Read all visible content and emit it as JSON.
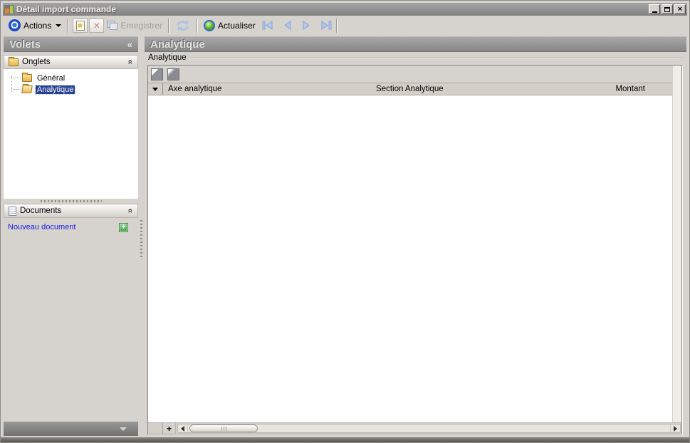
{
  "window": {
    "title": "Détail import commande",
    "close_glyph": "×"
  },
  "toolbar": {
    "actions_label": "Actions",
    "save_label": "Enregistrer",
    "refresh_label": "Actualiser"
  },
  "sidebar": {
    "header": "Volets",
    "collapse_glyph": "«",
    "onglets_title": "Onglets",
    "documents_title": "Documents",
    "section_collapse_glyph": "«",
    "tree": [
      {
        "label": "Général"
      },
      {
        "label": "Analytique"
      }
    ],
    "new_document_label": "Nouveau document",
    "new_document_plus": "+"
  },
  "main": {
    "header": "Analytique",
    "group_label": "Analytique",
    "grid": {
      "columns": [
        "Axe analytique",
        "Section Analytique",
        "Montant"
      ],
      "rows": [],
      "add_row_glyph": "+"
    }
  },
  "colors": {
    "selection": "#26418f",
    "link": "#1a1ae6",
    "add_green": "#3f9e3f",
    "titlebar_gray": "#8a8a8a"
  }
}
